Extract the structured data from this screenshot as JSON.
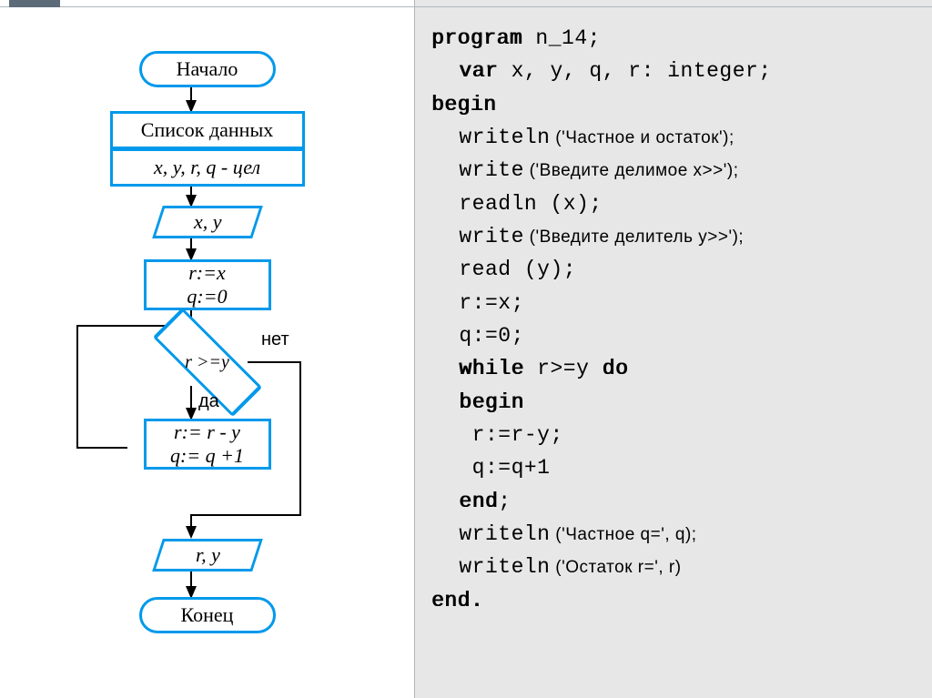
{
  "flowchart": {
    "start": "Начало",
    "data_row1": "Список данных",
    "data_row2": "x, y, r, q - цел",
    "io_in": "x, y",
    "proc1_l1": "r:=x",
    "proc1_l2": "q:=0",
    "decision": "r >=y",
    "label_no": "нет",
    "label_yes": "да",
    "proc2_l1": "r:= r - y",
    "proc2_l2": "q:= q +1",
    "io_out": "r, y",
    "end": "Конец"
  },
  "code": {
    "kw_program": "program",
    "prog_rest": " n_14;",
    "kw_var": "var",
    "var_rest": " x, y, q, r: integer;",
    "kw_begin": "begin",
    "writeln1a": "writeln",
    "writeln1b": " ('Частное и остаток');",
    "write1a": "write",
    "write1b": "  ('Введите делимое x>>');",
    "readln_a": "readln",
    "readln_b": " (x);",
    "write2a": "write",
    "write2b": " ('Введите делитель y>>');",
    "read_a": "read",
    "read_b": " (y);",
    "assign_r": "r:=x;",
    "assign_q": "q:=0;",
    "kw_while": "while",
    "while_mid": " r>=y ",
    "kw_do": "do",
    "kw_begin2": "begin",
    "body_r": " r:=r-y;",
    "body_q": " q:=q+1",
    "kw_end1": "end",
    "end1_semi": ";",
    "wq_a": "writeln",
    "wq_b": " ('Частное q=', q);",
    "wr_a": "writeln",
    "wr_b": " ('Остаток r=', r)",
    "kw_end2": "end."
  }
}
